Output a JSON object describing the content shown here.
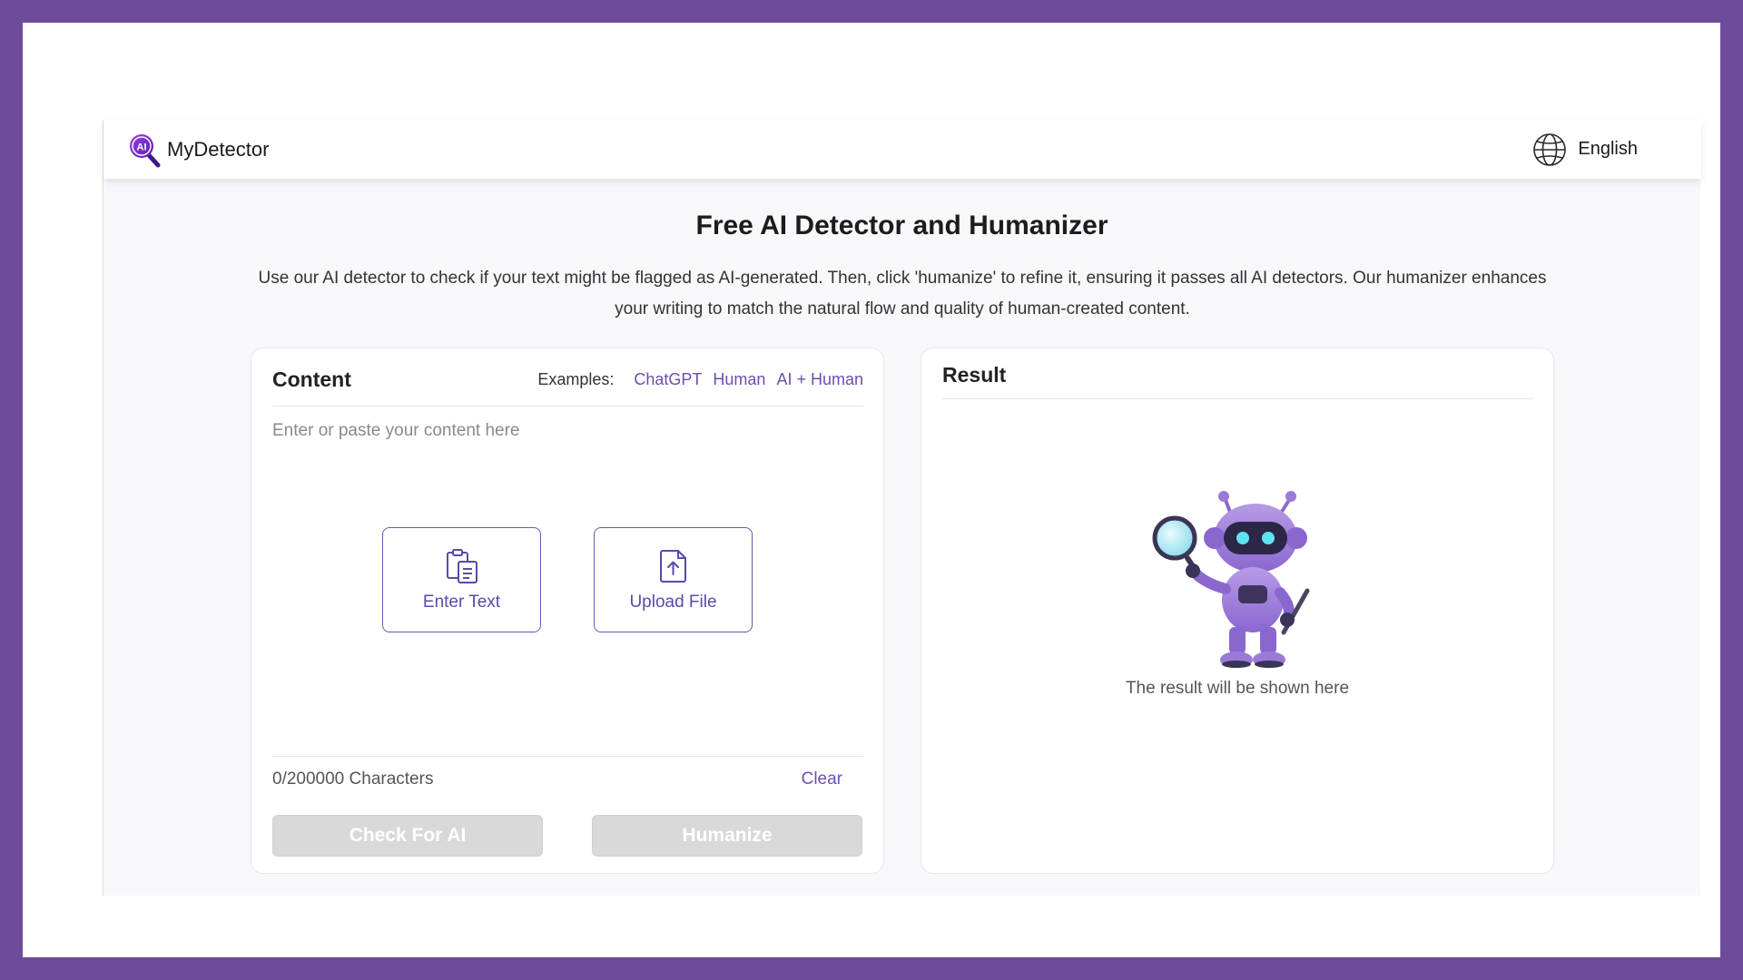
{
  "header": {
    "brand_name": "MyDetector",
    "logo_icon": "ai-magnifier-logo-icon",
    "language_icon": "globe-icon",
    "language_label": "English"
  },
  "hero": {
    "title": "Free AI Detector and Humanizer",
    "description": "Use our AI detector to check if your text might be flagged as AI-generated. Then, click 'humanize' to refine it, ensuring it passes all AI detectors. Our humanizer enhances your writing to match the natural flow and quality of human-created content."
  },
  "content": {
    "title": "Content",
    "examples_label": "Examples:",
    "examples": [
      "ChatGPT",
      "Human",
      "AI + Human"
    ],
    "placeholder": "Enter or paste your content here",
    "enter_text_label": "Enter Text",
    "enter_text_icon": "clipboard-text-icon",
    "upload_file_label": "Upload File",
    "upload_file_icon": "file-upload-icon",
    "char_count": "0/200000 Characters",
    "clear_label": "Clear",
    "check_label": "Check For AI",
    "humanize_label": "Humanize"
  },
  "result": {
    "title": "Result",
    "illustration": "robot-magnifier-illustration",
    "empty_text": "The result will be shown here"
  },
  "colors": {
    "frame": "#6e4b9a",
    "accent": "#6b4fb0",
    "disabled_button": "#d9d9d9"
  }
}
